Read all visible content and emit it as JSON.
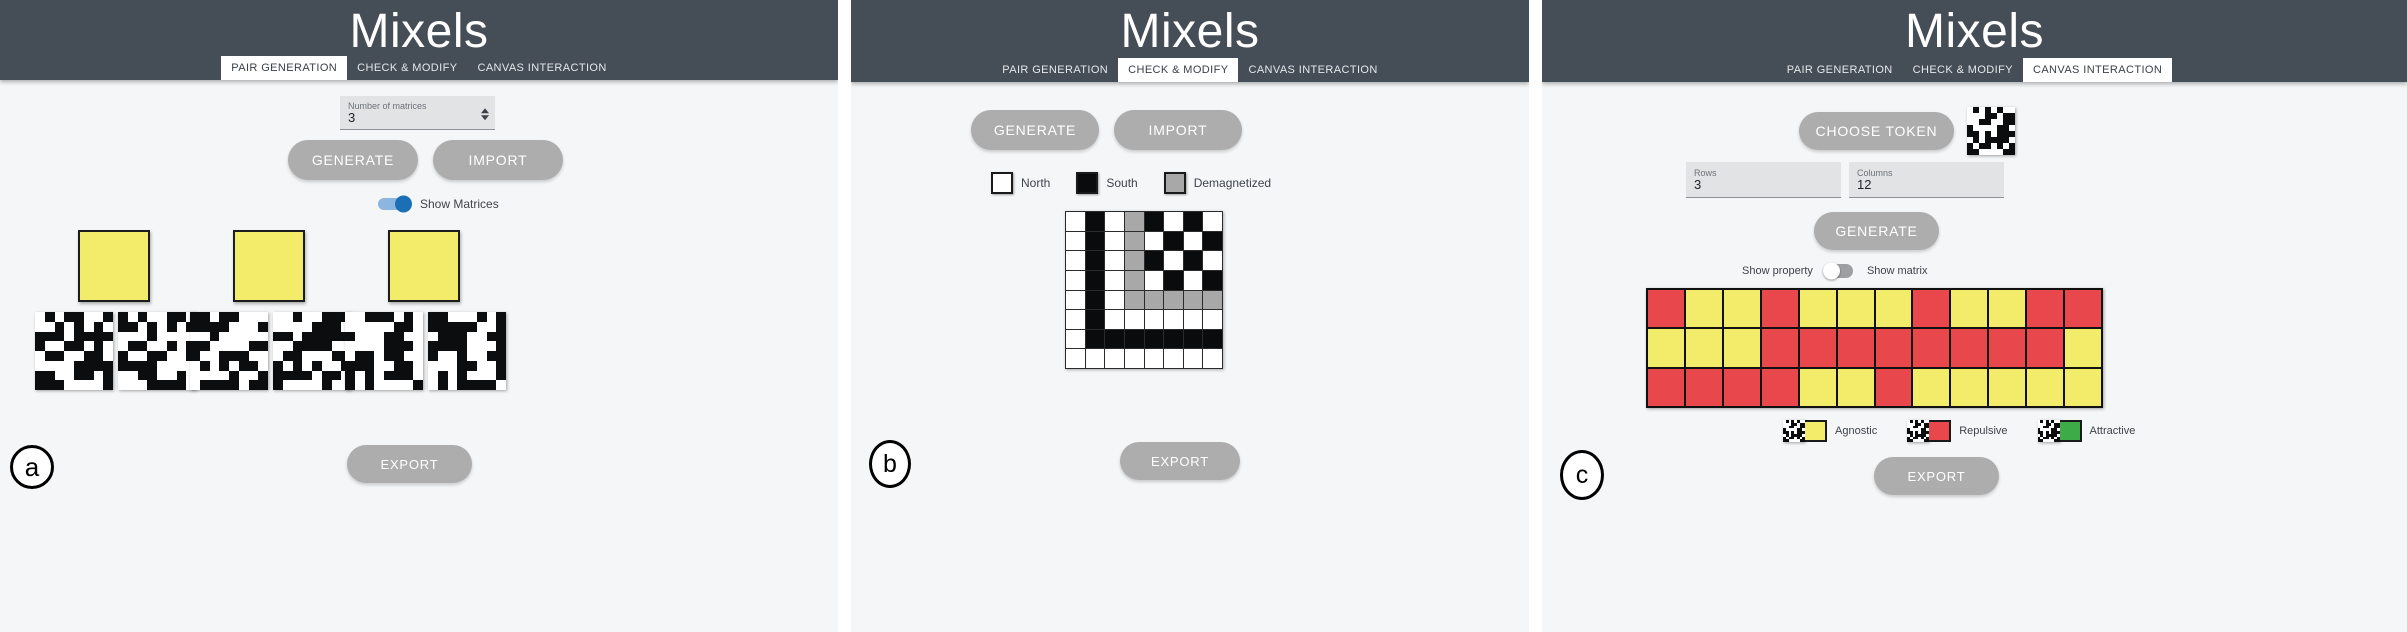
{
  "app": {
    "title": "Mixels",
    "accent_dark": "#454d57",
    "page_bg": "#f4f6f8",
    "button_gray": "#adadad",
    "yellow": "#f2ec6a",
    "red": "#e8474b",
    "green": "#3dab48",
    "gray_cell": "#a8a8a8"
  },
  "tabs": [
    {
      "label": "PAIR GENERATION"
    },
    {
      "label": "CHECK & MODIFY"
    },
    {
      "label": "CANVAS INTERACTION"
    }
  ],
  "panels": [
    {
      "letter": "a",
      "active_tab": 0,
      "controls": {
        "number_of_matrices": {
          "label": "Number of matrices",
          "value": "3"
        },
        "generate_label": "GENERATE",
        "import_label": "IMPORT",
        "show_matrices": {
          "label": "Show Matrices",
          "state": "on"
        },
        "export_label": "EXPORT"
      },
      "plates": [
        {
          "color": "#f2ec6a"
        },
        {
          "color": "#f2ec6a"
        },
        {
          "color": "#f2ec6a"
        }
      ],
      "matrix_pairs": 3
    },
    {
      "letter": "b",
      "active_tab": 1,
      "controls": {
        "generate_label": "GENERATE",
        "import_label": "IMPORT",
        "export_label": "EXPORT"
      },
      "legend": [
        {
          "name": "North",
          "color": "#ffffff"
        },
        {
          "name": "South",
          "color": "#090b0d"
        },
        {
          "name": "Demagnetized",
          "color": "#a8a8a8"
        }
      ],
      "matrix": {
        "rows": 8,
        "cols": 8,
        "cells": [
          [
            "N",
            "S",
            "N",
            "D",
            "S",
            "N",
            "S",
            "N"
          ],
          [
            "N",
            "S",
            "N",
            "D",
            "N",
            "S",
            "N",
            "S"
          ],
          [
            "N",
            "S",
            "N",
            "D",
            "S",
            "N",
            "S",
            "N"
          ],
          [
            "N",
            "S",
            "N",
            "D",
            "N",
            "S",
            "N",
            "S"
          ],
          [
            "N",
            "S",
            "N",
            "D",
            "D",
            "D",
            "D",
            "D"
          ],
          [
            "N",
            "S",
            "N",
            "N",
            "N",
            "N",
            "N",
            "N"
          ],
          [
            "N",
            "S",
            "S",
            "S",
            "S",
            "S",
            "S",
            "S"
          ],
          [
            "N",
            "N",
            "N",
            "N",
            "N",
            "N",
            "N",
            "N"
          ]
        ]
      }
    },
    {
      "letter": "c",
      "active_tab": 2,
      "controls": {
        "choose_token_label": "CHOOSE TOKEN",
        "rows": {
          "label": "Rows",
          "value": "3"
        },
        "columns": {
          "label": "Columns",
          "value": "12"
        },
        "generate_label": "GENERATE",
        "show_property_label": "Show property",
        "show_matrix_label": "Show matrix",
        "toggle_state": "off",
        "export_label": "EXPORT"
      },
      "legend": [
        {
          "name": "Agnostic",
          "color": "#f2ec6a"
        },
        {
          "name": "Repulsive",
          "color": "#e8474b"
        },
        {
          "name": "Attractive",
          "color": "#3dab48"
        }
      ],
      "canvas": {
        "rows": 3,
        "cols": 12,
        "cells": [
          [
            "R",
            "Y",
            "Y",
            "R",
            "Y",
            "Y",
            "Y",
            "R",
            "Y",
            "Y",
            "R",
            "R"
          ],
          [
            "Y",
            "Y",
            "Y",
            "R",
            "R",
            "R",
            "R",
            "R",
            "R",
            "R",
            "R",
            "Y"
          ],
          [
            "R",
            "R",
            "R",
            "R",
            "Y",
            "Y",
            "R",
            "Y",
            "Y",
            "Y",
            "Y",
            "Y"
          ]
        ]
      }
    }
  ]
}
